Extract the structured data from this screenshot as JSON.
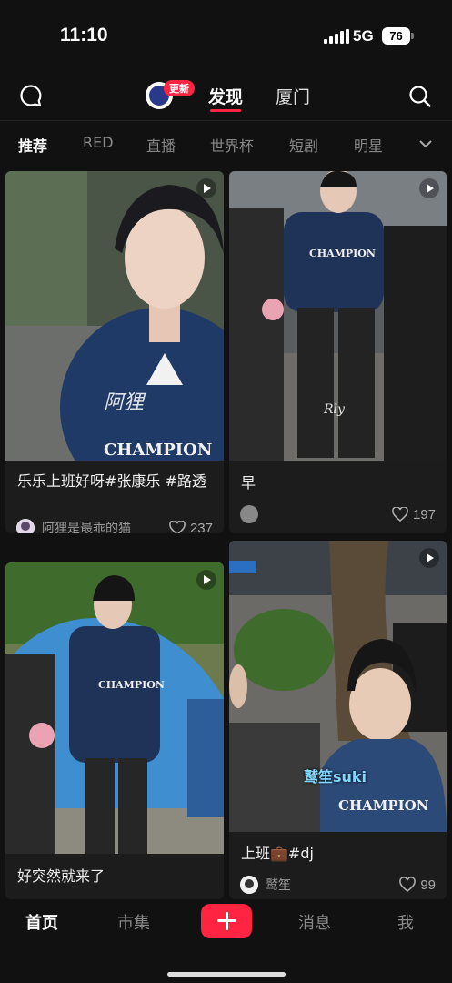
{
  "status_bar": {
    "time": "11:10",
    "network": "5G",
    "battery": "76"
  },
  "header": {
    "update_badge": "更新",
    "tabs": [
      {
        "label": "发现"
      },
      {
        "label": "厦门"
      }
    ]
  },
  "categories": [
    "推荐",
    "RED",
    "直播",
    "世界杯",
    "短剧",
    "明星"
  ],
  "cards": [
    {
      "title": "乐乐上班好呀#张康乐 #路透",
      "author": "阿狸是最乖的猫",
      "likes": "237",
      "watermark": "阿狸"
    },
    {
      "title": "早",
      "author": "",
      "likes": "197",
      "watermark": "Rly"
    },
    {
      "title": "好突然就来了",
      "author": "",
      "likes": ""
    },
    {
      "title": "上班💼#dj",
      "author": "鹫笙",
      "likes": "99",
      "overlay": "鹫笙suki"
    }
  ],
  "shirt_text": "CHAMPION",
  "bottom_nav": {
    "items": [
      "首页",
      "市集",
      "消息",
      "我"
    ]
  },
  "colors": {
    "accent": "#ff2442",
    "background": "#111111",
    "card": "#1c1c1c"
  }
}
